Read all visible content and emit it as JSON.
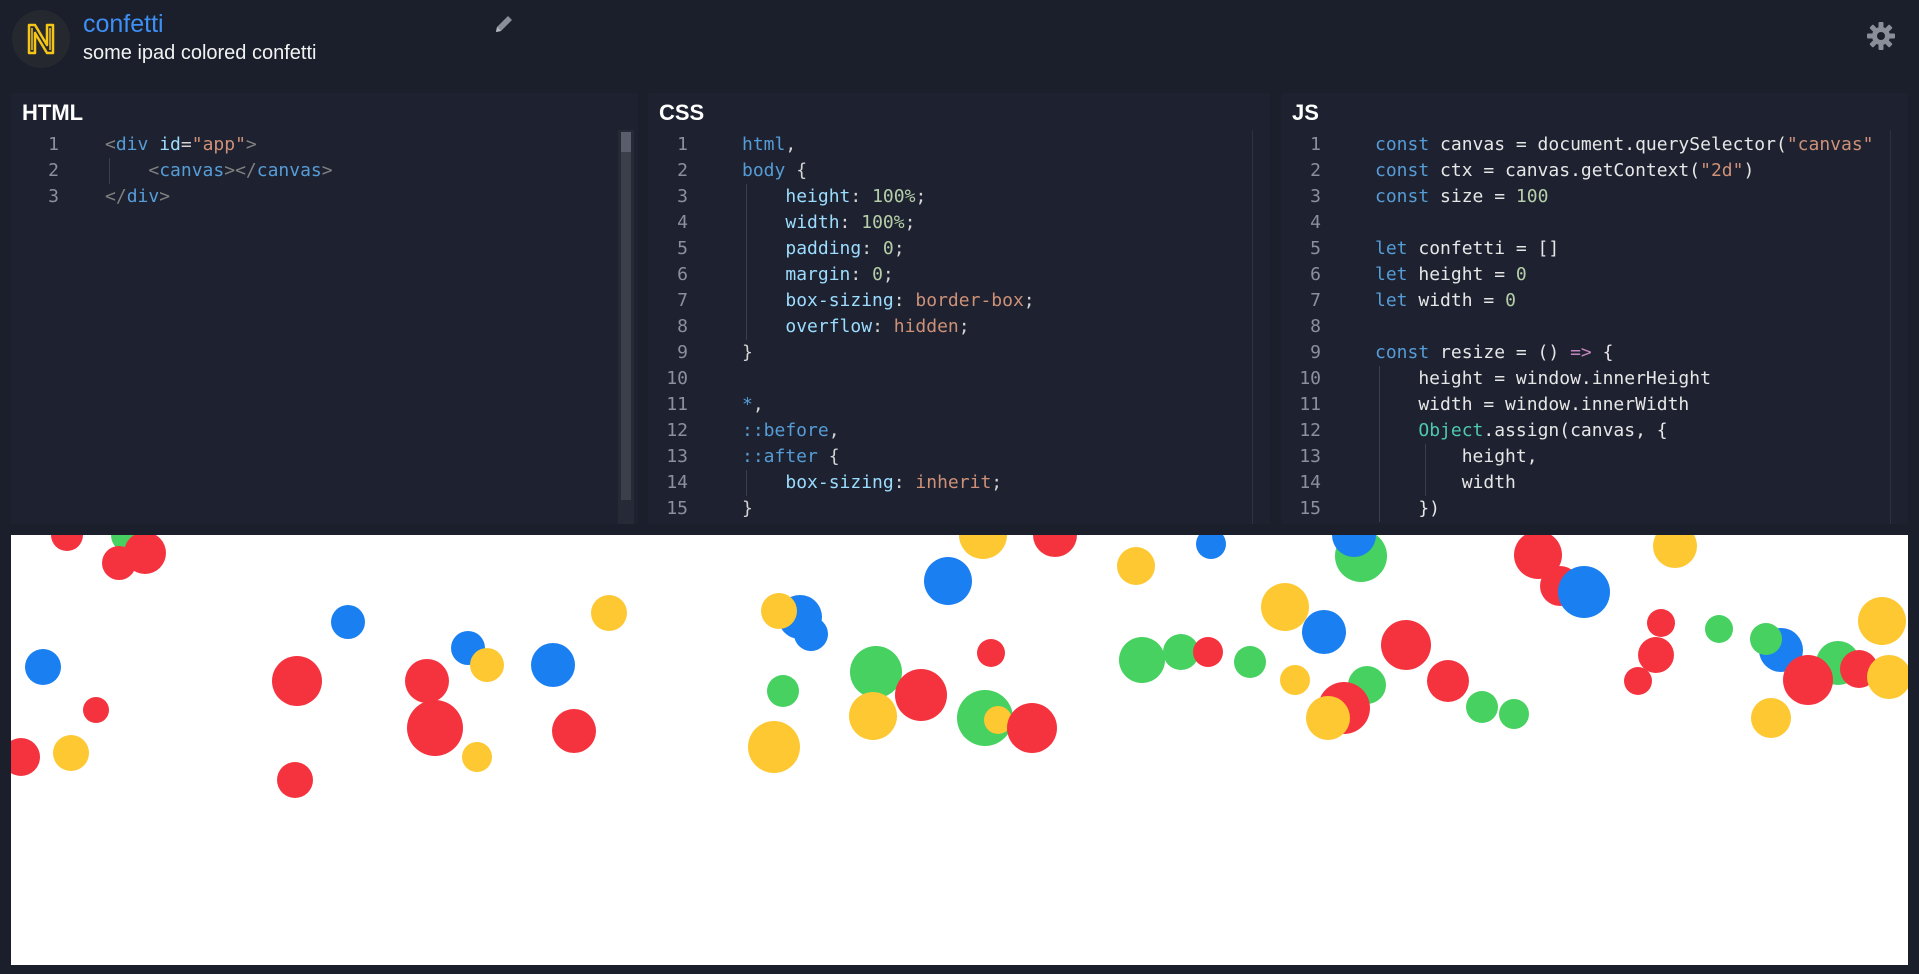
{
  "header": {
    "title": "confetti",
    "description": "some ipad colored confetti"
  },
  "panels": {
    "html": {
      "label": "HTML",
      "lines": [
        {
          "n": "1",
          "html": "<span class=\"g\">&lt;</span><span class=\"t\">div</span> <span class=\"a\">id</span><span class=\"p\">=</span><span class=\"s\">\"app\"</span><span class=\"g\">&gt;</span>"
        },
        {
          "n": "2",
          "html": "    <span class=\"g\">&lt;</span><span class=\"t\">canvas</span><span class=\"g\">&gt;&lt;/</span><span class=\"t\">canvas</span><span class=\"g\">&gt;</span>"
        },
        {
          "n": "3",
          "html": "<span class=\"g\">&lt;/</span><span class=\"t\">div</span><span class=\"g\">&gt;</span>"
        }
      ]
    },
    "css": {
      "label": "CSS",
      "lines": [
        {
          "n": "1",
          "html": "<span class=\"sel\" style=\"color:#569cd6\">html</span><span class=\"p\">,</span>"
        },
        {
          "n": "2",
          "html": "<span class=\"sel\" style=\"color:#569cd6\">body</span> <span class=\"p\">{</span>"
        },
        {
          "n": "3",
          "html": "    <span class=\"a\">height</span><span class=\"p\">:</span> <span class=\"n\">100%</span><span class=\"p\">;</span>"
        },
        {
          "n": "4",
          "html": "    <span class=\"a\">width</span><span class=\"p\">:</span> <span class=\"n\">100%</span><span class=\"p\">;</span>"
        },
        {
          "n": "5",
          "html": "    <span class=\"a\">padding</span><span class=\"p\">:</span> <span class=\"n\">0</span><span class=\"p\">;</span>"
        },
        {
          "n": "6",
          "html": "    <span class=\"a\">margin</span><span class=\"p\">:</span> <span class=\"n\">0</span><span class=\"p\">;</span>"
        },
        {
          "n": "7",
          "html": "    <span class=\"a\">box-sizing</span><span class=\"p\">:</span> <span class=\"s\">border-box</span><span class=\"p\">;</span>"
        },
        {
          "n": "8",
          "html": "    <span class=\"a\">overflow</span><span class=\"p\">:</span> <span class=\"s\">hidden</span><span class=\"p\">;</span>"
        },
        {
          "n": "9",
          "html": "<span class=\"p\">}</span>"
        },
        {
          "n": "10",
          "html": ""
        },
        {
          "n": "11",
          "html": "<span class=\"k\">*</span><span class=\"p\">,</span>"
        },
        {
          "n": "12",
          "html": "<span class=\"k\">::before</span><span class=\"p\">,</span>"
        },
        {
          "n": "13",
          "html": "<span class=\"k\">::after</span> <span class=\"p\">{</span>"
        },
        {
          "n": "14",
          "html": "    <span class=\"a\">box-sizing</span><span class=\"p\">:</span> <span class=\"s\">inherit</span><span class=\"p\">;</span>"
        },
        {
          "n": "15",
          "html": "<span class=\"p\">}</span>"
        }
      ]
    },
    "js": {
      "label": "JS",
      "lines": [
        {
          "n": "1",
          "html": "<span class=\"k\">const</span> canvas = document.querySelector(<span class=\"s\">\"canvas\"</span>"
        },
        {
          "n": "2",
          "html": "<span class=\"k\">const</span> ctx = canvas.getContext(<span class=\"s\">\"2d\"</span>)"
        },
        {
          "n": "3",
          "html": "<span class=\"k\">const</span> size = <span class=\"n\">100</span>"
        },
        {
          "n": "4",
          "html": ""
        },
        {
          "n": "5",
          "html": "<span class=\"k\">let</span> confetti = []"
        },
        {
          "n": "6",
          "html": "<span class=\"k\">let</span> height = <span class=\"n\">0</span>"
        },
        {
          "n": "7",
          "html": "<span class=\"k\">let</span> width = <span class=\"n\">0</span>"
        },
        {
          "n": "8",
          "html": ""
        },
        {
          "n": "9",
          "html": "<span class=\"k\">const</span> resize = () <span class=\"o\">=&gt;</span> {"
        },
        {
          "n": "10",
          "html": "    height = window.innerHeight"
        },
        {
          "n": "11",
          "html": "    width = window.innerWidth"
        },
        {
          "n": "12",
          "html": "    <span class=\"cls\">Object</span>.assign(canvas, {"
        },
        {
          "n": "13",
          "html": "        height,"
        },
        {
          "n": "14",
          "html": "        width"
        },
        {
          "n": "15",
          "html": "    })"
        }
      ]
    }
  },
  "confetti": {
    "colors": {
      "red": "#f5333f",
      "green": "#46d160",
      "blue": "#1a7ff0",
      "yellow": "#fdc831"
    }
  }
}
